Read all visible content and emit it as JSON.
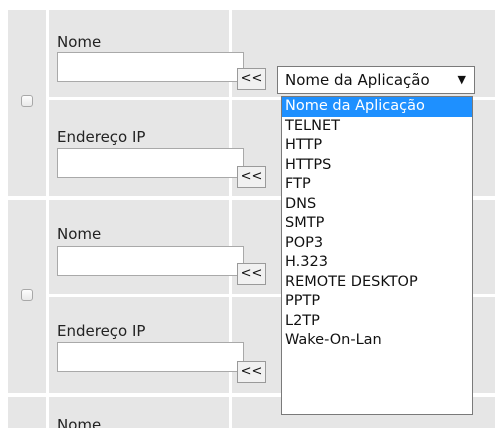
{
  "theme": {
    "cell_bg": "#e6e6e6",
    "highlight": "#1e90ff",
    "icons": [
      "checkbox",
      "chevron-down-icon"
    ]
  },
  "rows": [
    {
      "name_label": "Nome",
      "name_value": "",
      "ip_label": "Endereço IP",
      "ip_value": "",
      "copy_label": "<<"
    },
    {
      "name_label": "Nome",
      "name_value": "",
      "ip_label": "Endereço IP",
      "ip_value": "",
      "copy_label": "<<"
    },
    {
      "name_label": "Nome"
    }
  ],
  "app_select": {
    "selected": "Nome da Aplicação",
    "arrow": "▼",
    "options": [
      "Nome da Aplicação",
      "TELNET",
      "HTTP",
      "HTTPS",
      "FTP",
      "DNS",
      "SMTP",
      "POP3",
      "H.323",
      "REMOTE DESKTOP",
      "PPTP",
      "L2TP",
      "Wake-On-Lan"
    ]
  }
}
